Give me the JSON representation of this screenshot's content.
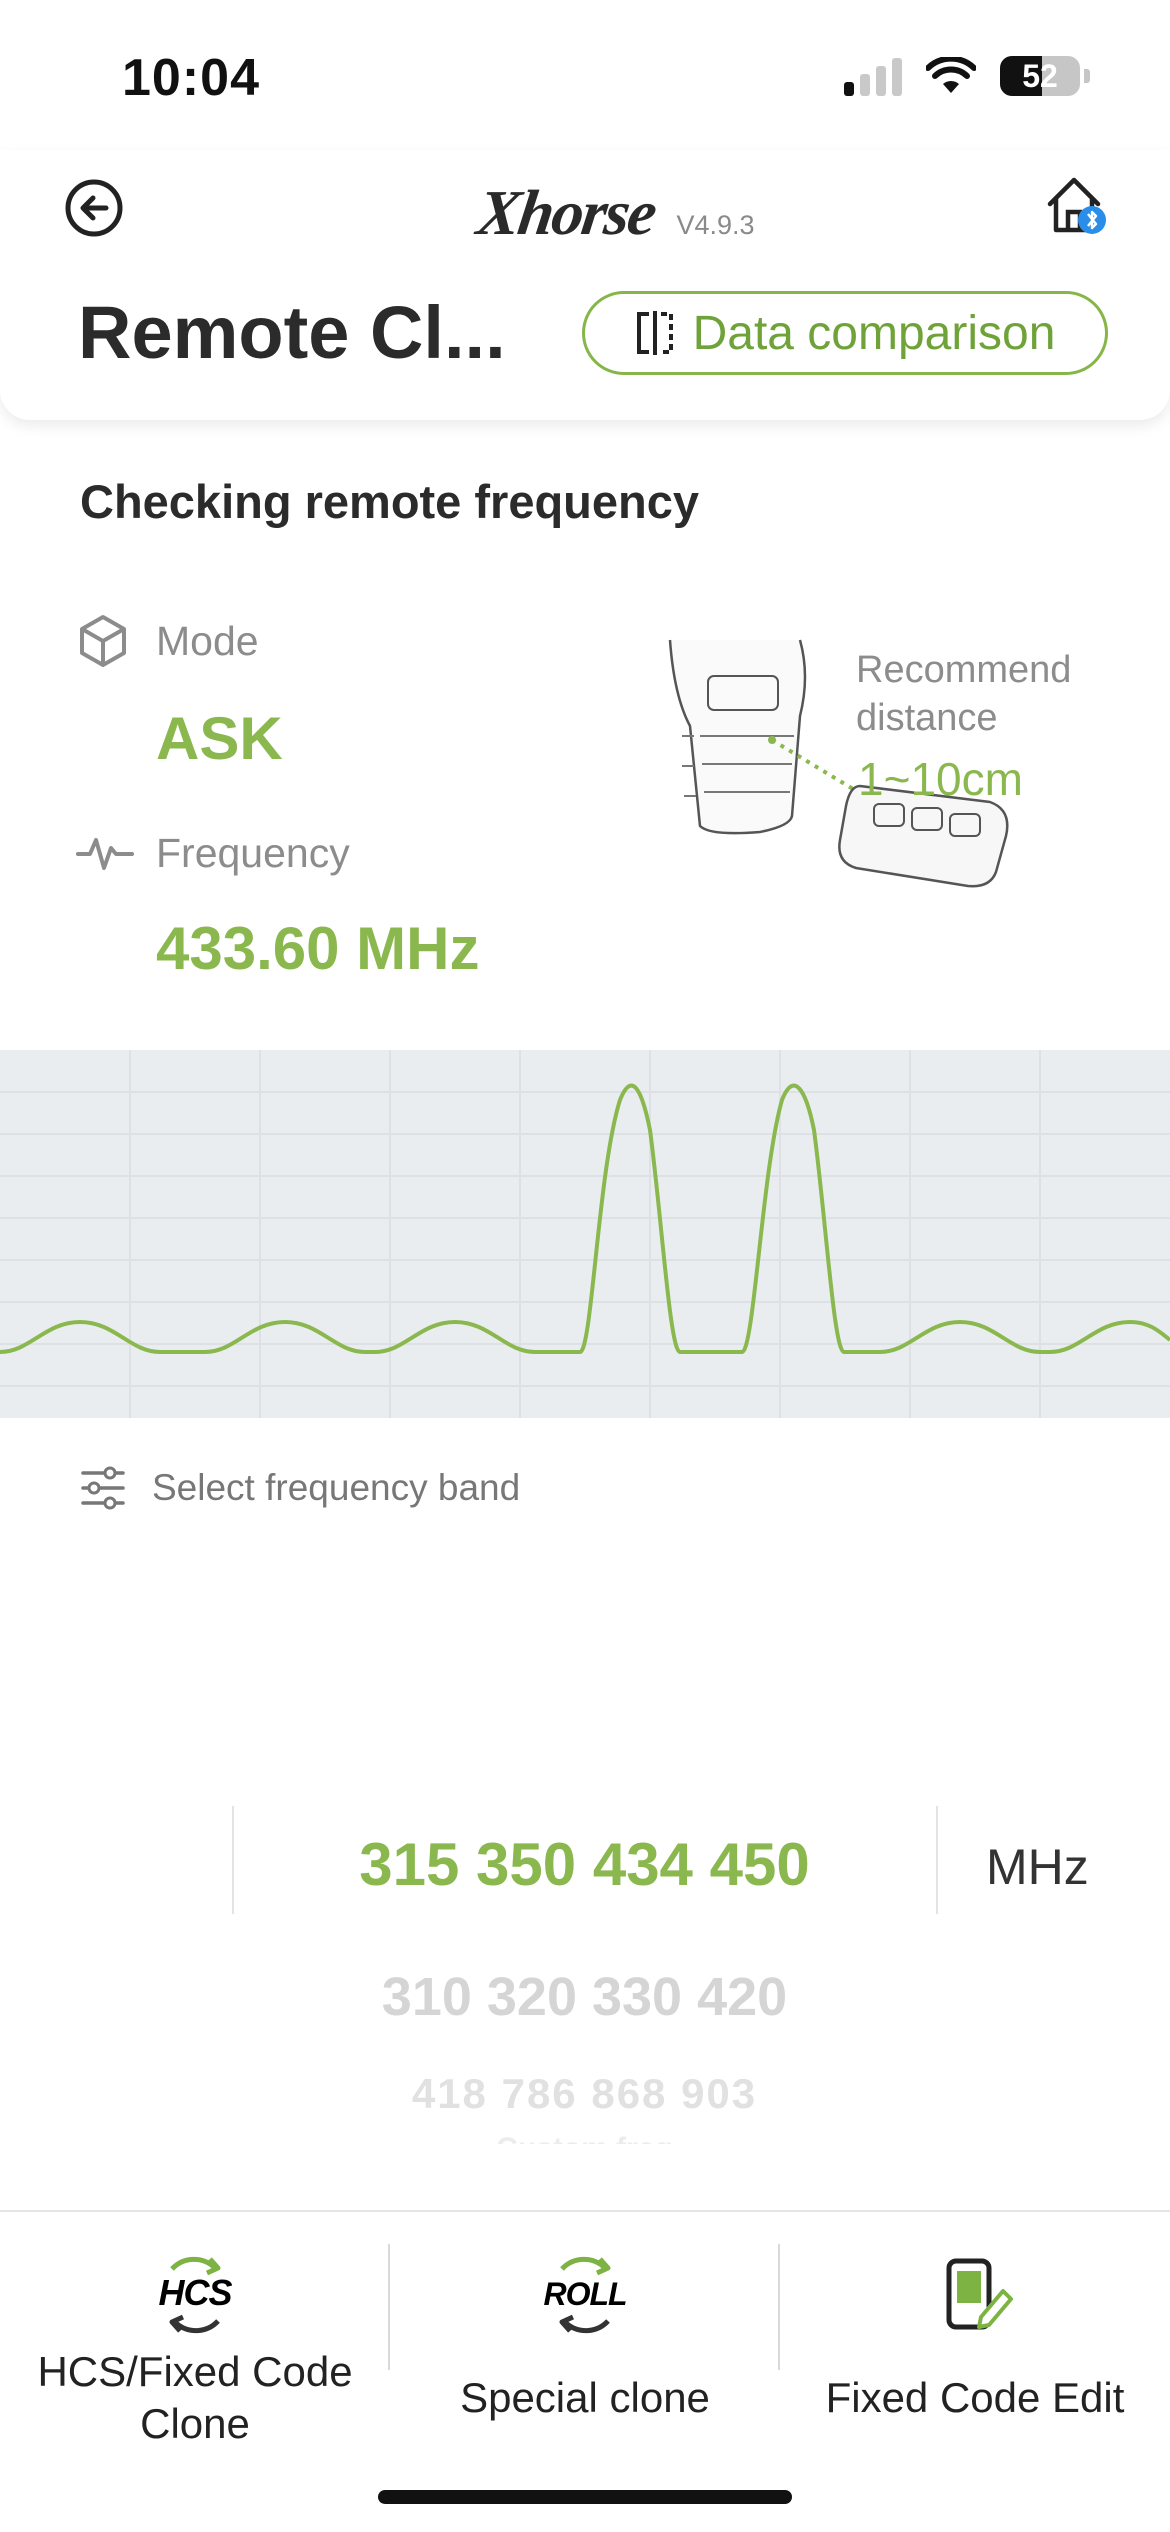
{
  "status_bar": {
    "time": "10:04",
    "battery": "52",
    "battery_level": 0.52
  },
  "header": {
    "brand": "Xhorse",
    "version": "V4.9.3",
    "title": "Remote Cl...",
    "compare_label": "Data comparison"
  },
  "detection": {
    "section_title": "Checking remote frequency",
    "mode_label": "Mode",
    "mode_value": "ASK",
    "frequency_label": "Frequency",
    "frequency_value": "433.60 MHz",
    "recommend_label_line1": "Recommend",
    "recommend_label_line2": "distance",
    "recommend_value": "1~10cm"
  },
  "band": {
    "label": "Select frequency band"
  },
  "picker": {
    "selected": "315 350 434 450",
    "row2": "310 320 330 420",
    "row3": "418 786 868 903",
    "row4": "Custom freq",
    "unit": "MHz"
  },
  "toolbar": {
    "items": [
      {
        "icon": "hcs-icon",
        "icon_text": "HCS",
        "label_line1": "HCS/Fixed Code",
        "label_line2": "Clone"
      },
      {
        "icon": "roll-icon",
        "icon_text": "ROLL",
        "label_line1": "Special clone"
      },
      {
        "icon": "edit-icon",
        "label_line1": "Fixed Code Edit"
      }
    ]
  },
  "colors": {
    "accent": "#8bb84e",
    "accent_dark": "#6fa33a",
    "chart_bg": "#eaedf0",
    "text": "#2b2b2b",
    "muted": "#8c8c8c"
  }
}
